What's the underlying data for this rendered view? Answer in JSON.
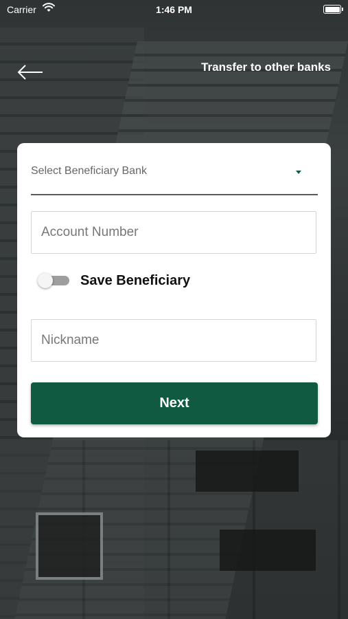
{
  "status_bar": {
    "carrier": "Carrier",
    "time": "1:46 PM"
  },
  "header": {
    "title": "Transfer to other banks",
    "back_icon": "arrow-left-icon"
  },
  "form": {
    "bank_select": {
      "placeholder": "Select Beneficiary Bank",
      "icon": "caret-down-icon"
    },
    "account_number": {
      "placeholder": "Account Number",
      "value": ""
    },
    "save_beneficiary": {
      "label": "Save Beneficiary",
      "enabled": false
    },
    "nickname": {
      "placeholder": "Nickname",
      "value": ""
    },
    "next_label": "Next"
  },
  "colors": {
    "primary": "#0f5a40",
    "card": "#ffffff",
    "header_text": "#ffffff"
  }
}
